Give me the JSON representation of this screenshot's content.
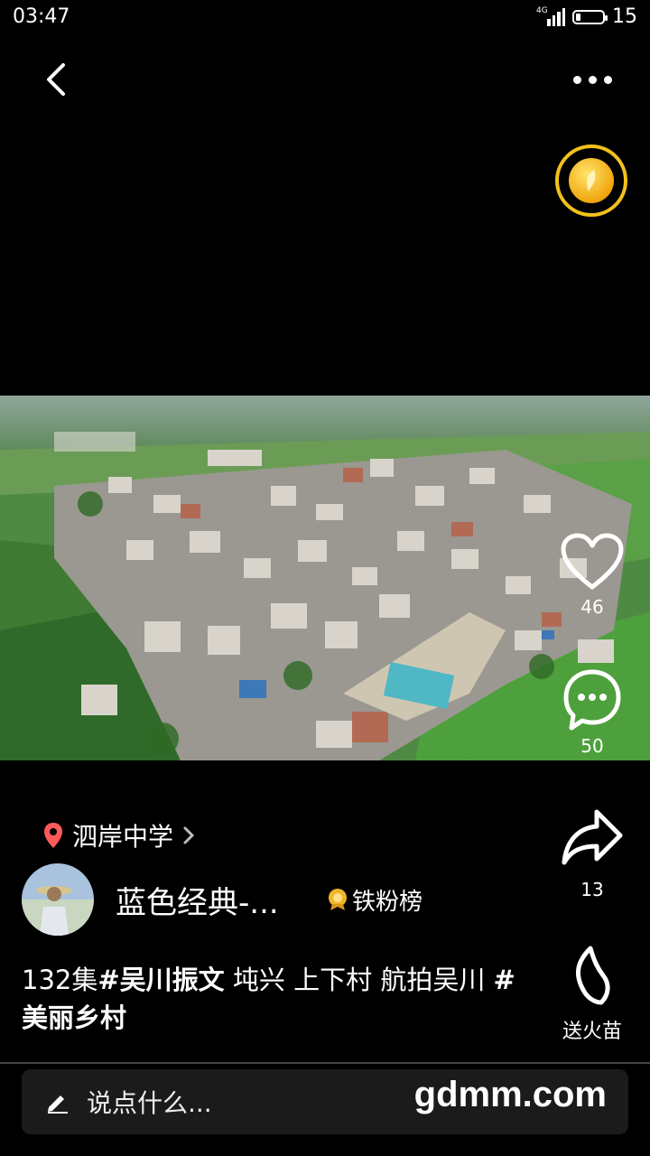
{
  "status": {
    "time": "03:47",
    "network": "4G",
    "battery": "15"
  },
  "video": {
    "theme": "aerial village view"
  },
  "actions": {
    "likes": "46",
    "comments": "50",
    "shares": "13",
    "fire_label": "送火苗"
  },
  "location": {
    "name": "泗岸中学"
  },
  "author": {
    "name": "蓝色经典-...",
    "badge": "铁粉榜"
  },
  "caption": {
    "prefix": "132集",
    "tag1": "#吴川振文",
    "middle": " 坉兴 上下村 航拍吴川 ",
    "tag2": "#美丽乡村"
  },
  "comment_bar": {
    "placeholder": "说点什么...",
    "watermark": "gdmm.com"
  },
  "colors": {
    "accent_gold": "#f2c21a",
    "location_pin": "#ff5a5a"
  }
}
